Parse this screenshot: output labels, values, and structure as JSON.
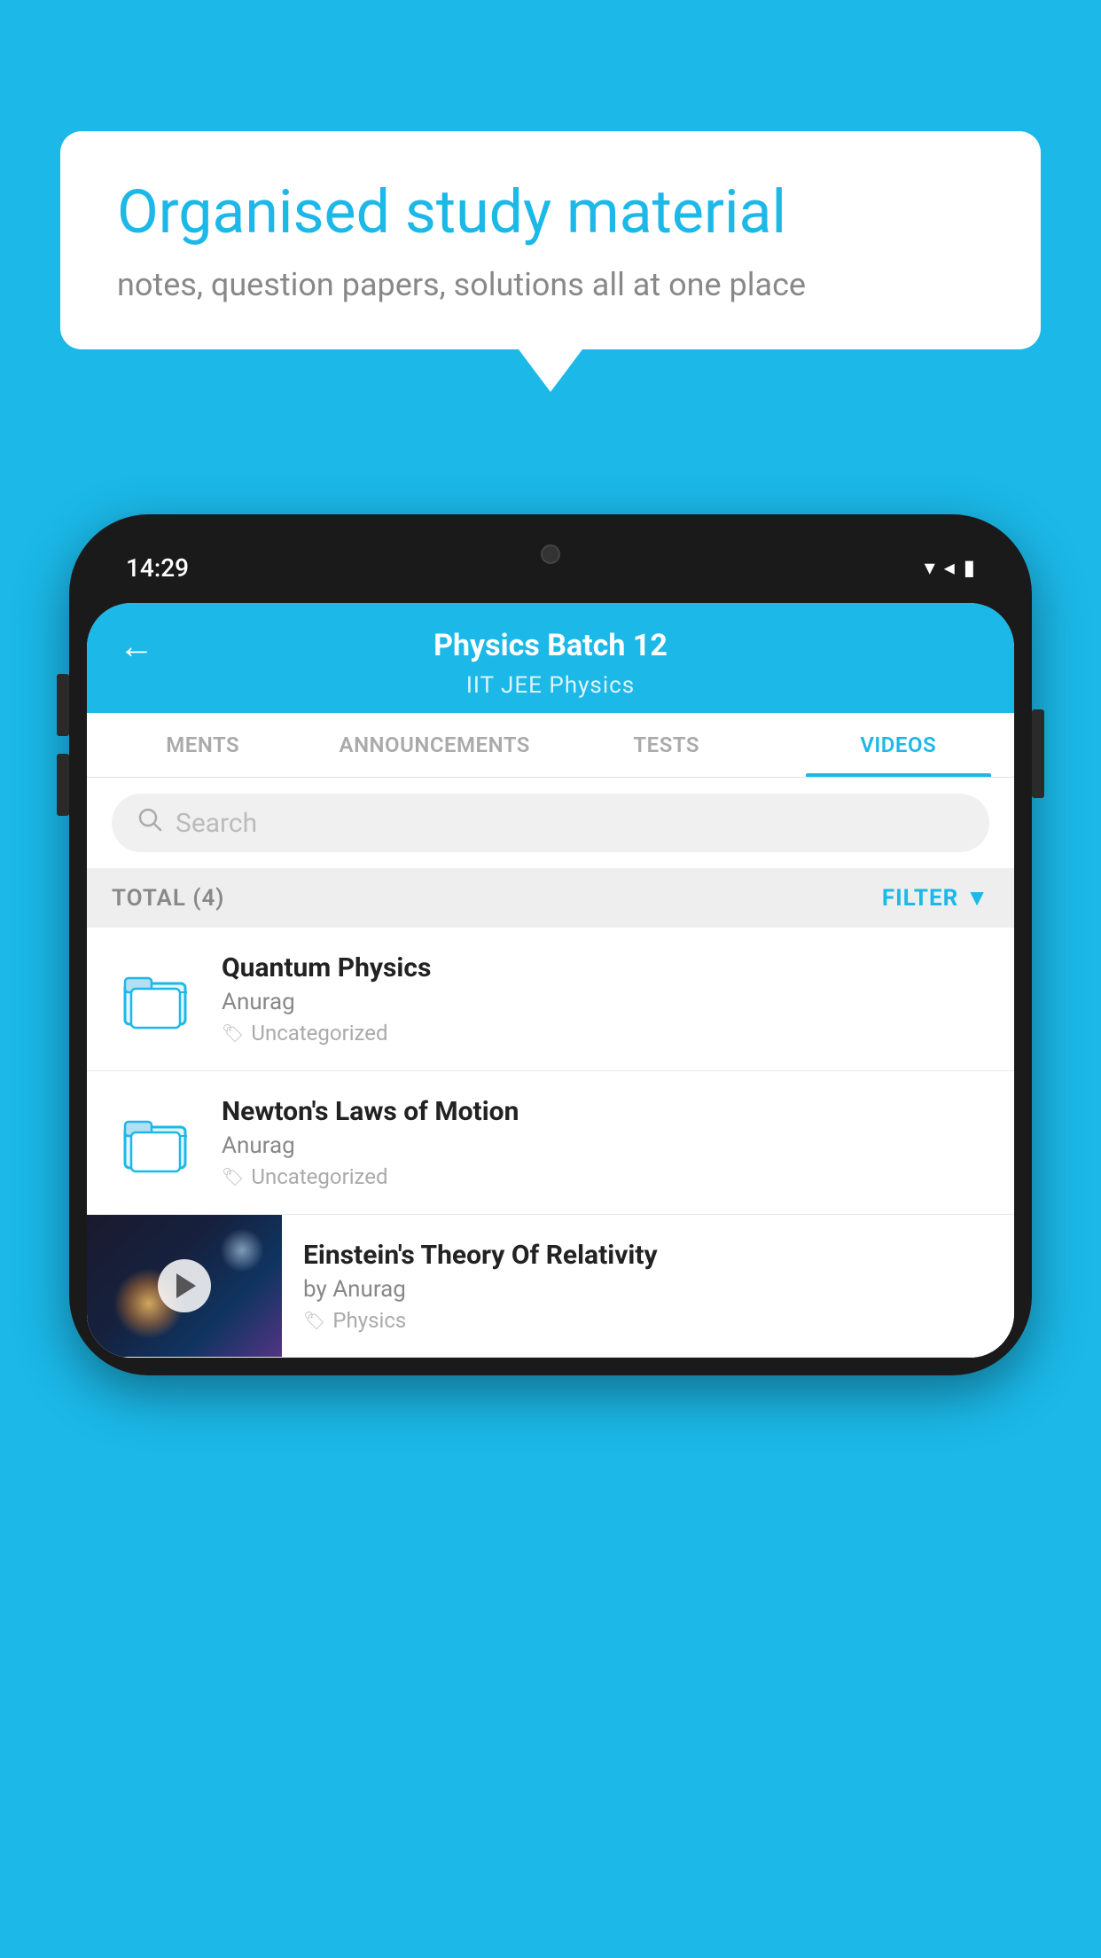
{
  "background_color": "#1bb8e8",
  "speech_bubble": {
    "title": "Organised study material",
    "subtitle": "notes, question papers, solutions all at one place"
  },
  "phone": {
    "time": "14:29",
    "status_bar": {
      "wifi": "▼",
      "signal": "▲",
      "battery": "▌"
    },
    "header": {
      "title": "Physics Batch 12",
      "subtitle": "IIT JEE   Physics",
      "back_label": "←"
    },
    "tabs": [
      {
        "label": "MENTS",
        "active": false
      },
      {
        "label": "ANNOUNCEMENTS",
        "active": false
      },
      {
        "label": "TESTS",
        "active": false
      },
      {
        "label": "VIDEOS",
        "active": true
      }
    ],
    "search": {
      "placeholder": "Search"
    },
    "filter_bar": {
      "total_label": "TOTAL (4)",
      "filter_label": "FILTER"
    },
    "videos": [
      {
        "title": "Quantum Physics",
        "author": "Anurag",
        "tag": "Uncategorized",
        "has_thumbnail": false
      },
      {
        "title": "Newton's Laws of Motion",
        "author": "Anurag",
        "tag": "Uncategorized",
        "has_thumbnail": false
      },
      {
        "title": "Einstein's Theory Of Relativity",
        "author": "by Anurag",
        "tag": "Physics",
        "has_thumbnail": true
      }
    ]
  }
}
